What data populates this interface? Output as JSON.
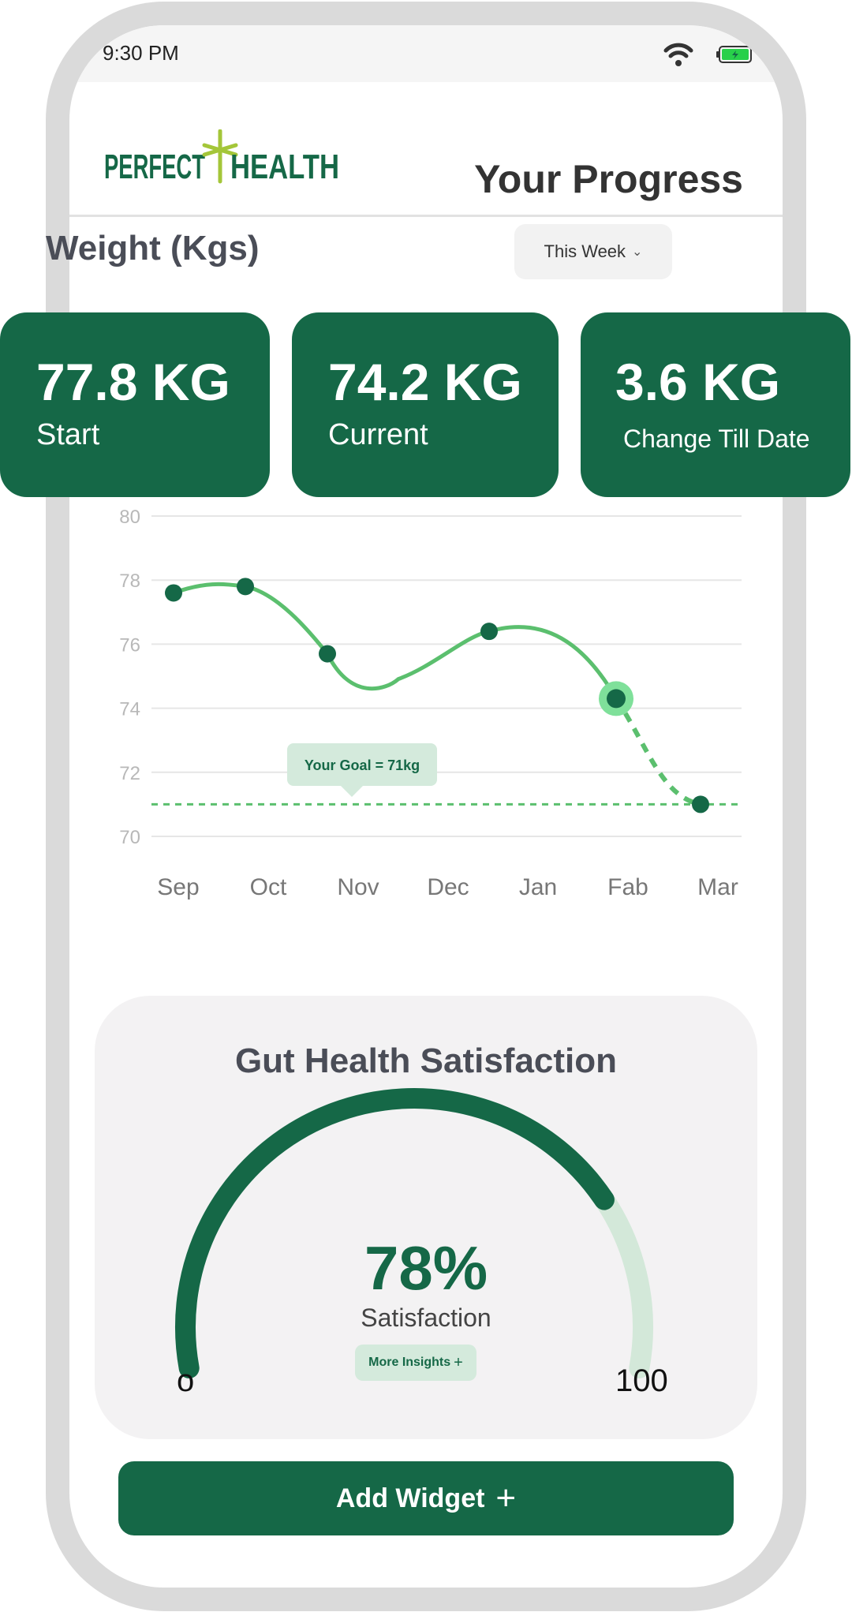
{
  "status_bar": {
    "time": "9:30 PM"
  },
  "header": {
    "logo_text_left": "PERFECT",
    "logo_text_right": "HEALTH",
    "title": "Your Progress"
  },
  "weight": {
    "title": "Weight (Kgs)",
    "period_label": "This Week",
    "cards": [
      {
        "value": "77.8 KG",
        "label": "Start"
      },
      {
        "value": "74.2 KG",
        "label": "Current"
      },
      {
        "value": "3.6 KG",
        "label": "Change Till Date"
      }
    ]
  },
  "chart_data": {
    "type": "line",
    "categories": [
      "Sep",
      "Oct",
      "Nov",
      "Dec",
      "Jan",
      "Fab",
      "Mar"
    ],
    "yticks": [
      80,
      78,
      76,
      74,
      72,
      70
    ],
    "ylim": [
      70,
      80
    ],
    "grid": true,
    "series": [
      {
        "values": [
          77.6,
          77.8,
          75.7,
          null,
          76.4,
          74.3,
          71.0
        ]
      }
    ],
    "current_point": {
      "x": "Fab",
      "y": 74.3
    },
    "projection": {
      "from": 74.3,
      "to": 71.0
    },
    "goal": {
      "value": 71,
      "label": "Your Goal = 71kg"
    }
  },
  "gut_health": {
    "title": "Gut Health Satisfaction",
    "value": 78,
    "value_label": "78%",
    "label": "Satisfaction",
    "insights_label": "More Insights",
    "min_label": "o",
    "max_label": "100"
  },
  "footer": {
    "add_widget_label": "Add Widget"
  },
  "colors": {
    "brand": "#156847",
    "accent_line": "#5bbf6e",
    "logo_star": "#a4c639"
  }
}
